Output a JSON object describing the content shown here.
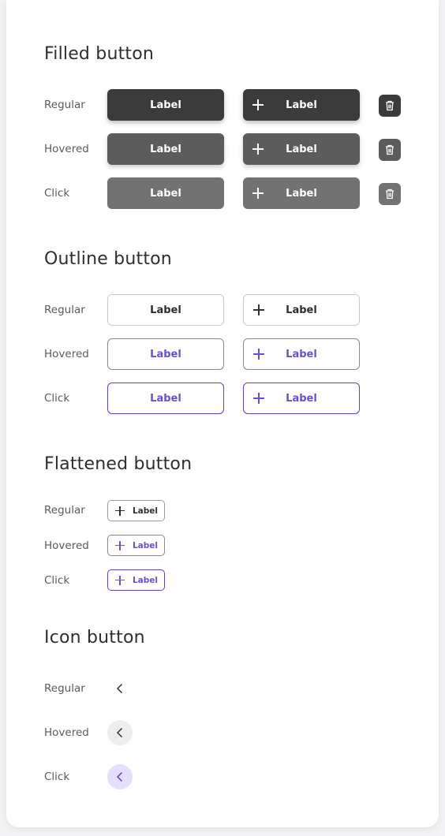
{
  "sections": {
    "filled": {
      "title": "Filled button"
    },
    "outline": {
      "title": "Outline button"
    },
    "flattened": {
      "title": "Flattened button"
    },
    "icon": {
      "title": "Icon button"
    }
  },
  "states": {
    "regular": "Regular",
    "hovered": "Hovered",
    "click": "Click"
  },
  "button_label": "Label",
  "colors": {
    "accent": "#6a4fd1",
    "filled_regular": "#3b3b3b",
    "filled_hover": "#5c5c5c",
    "filled_click": "#727272",
    "icon_hover_bg": "#ededed",
    "icon_click_bg": "#e4dfff"
  },
  "icons": {
    "plus": "plus-icon",
    "trash": "trash-icon",
    "back": "chevron-left-icon"
  }
}
